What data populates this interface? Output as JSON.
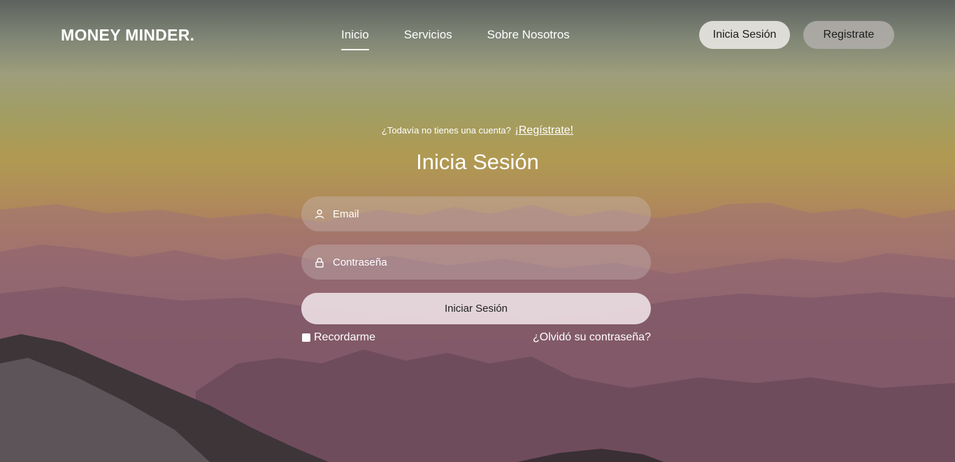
{
  "brand": {
    "name": "MONEY MINDER."
  },
  "nav": {
    "items": [
      {
        "label": "Inicio",
        "active": true
      },
      {
        "label": "Servicios",
        "active": false
      },
      {
        "label": "Sobre Nosotros",
        "active": false
      }
    ]
  },
  "header_buttons": {
    "login_label": "Inicia Sesión",
    "register_label": "Registrate"
  },
  "login": {
    "prompt_text": "¿Todavía no tienes una cuenta?",
    "prompt_link": "¡Regístrate!",
    "title": "Inicia Sesión",
    "email": {
      "placeholder": "Email",
      "value": "",
      "icon": "user-icon"
    },
    "password": {
      "placeholder": "Contraseña",
      "value": "",
      "icon": "lock-icon"
    },
    "submit_label": "Iniciar Sesión",
    "remember_label": "Recordarme",
    "remember_checked": false,
    "forgot_label": "¿Olvidó su contraseña?"
  },
  "colors": {
    "text": "#ffffff",
    "login_button_bg": "#e6e4e0",
    "register_button_bg": "#afaca8",
    "submit_bg": "#e8dade"
  }
}
